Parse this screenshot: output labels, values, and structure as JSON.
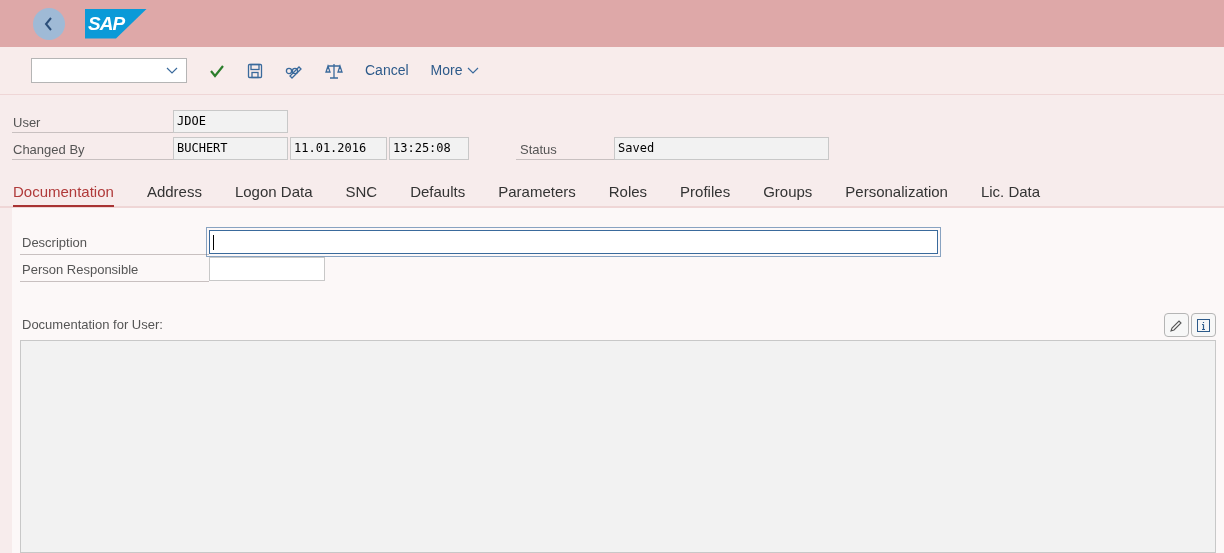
{
  "logo": "SAP",
  "toolbar": {
    "actions": [
      {
        "kind": "check"
      },
      {
        "kind": "save"
      },
      {
        "kind": "glasses-pencil"
      },
      {
        "kind": "scale"
      }
    ],
    "buttons": [
      {
        "label": "Cancel"
      },
      {
        "label": "More",
        "kind": "menu"
      }
    ]
  },
  "header_fields": [
    {
      "label": "User",
      "values": [
        "JDOE"
      ]
    },
    {
      "label": "Changed By",
      "values": [
        "BUCHERT",
        "11.01.2016",
        "13:25:08"
      ],
      "status": {
        "label": "Status",
        "value": "Saved"
      }
    }
  ],
  "tabs": [
    {
      "label": "Documentation",
      "selected": true
    },
    {
      "label": "Address",
      "selected": false
    },
    {
      "label": "Logon Data",
      "selected": false
    },
    {
      "label": "SNC",
      "selected": false
    },
    {
      "label": "Defaults",
      "selected": false
    },
    {
      "label": "Parameters",
      "selected": false
    },
    {
      "label": "Roles",
      "selected": false
    },
    {
      "label": "Profiles",
      "selected": false
    },
    {
      "label": "Groups",
      "selected": false
    },
    {
      "label": "Personalization",
      "selected": false
    },
    {
      "label": "Lic. Data",
      "selected": false
    }
  ],
  "form": [
    {
      "label": "Description",
      "focused": true
    },
    {
      "label": "Person Responsible",
      "focused": false
    }
  ],
  "documentation": {
    "label": "Documentation for User:"
  }
}
